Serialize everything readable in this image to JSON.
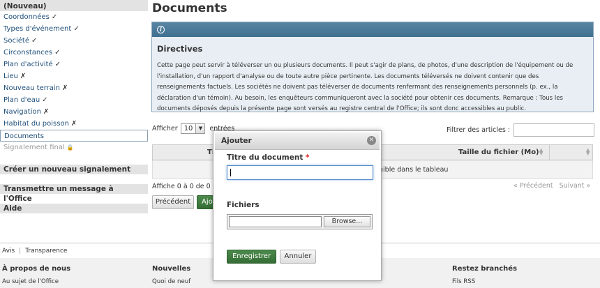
{
  "sidebar": {
    "header": "(Nouveau)",
    "items": [
      {
        "label": "Coordonnées",
        "mark": "✓"
      },
      {
        "label": "Types d'événement",
        "mark": "✓"
      },
      {
        "label": "Société",
        "mark": "✓"
      },
      {
        "label": "Circonstances",
        "mark": "✓"
      },
      {
        "label": "Plan d'activité",
        "mark": "✓"
      },
      {
        "label": "Lieu",
        "mark": "✗"
      },
      {
        "label": "Nouveau terrain",
        "mark": "✗"
      },
      {
        "label": "Plan d'eau",
        "mark": "✓"
      },
      {
        "label": "Navigation",
        "mark": "✗"
      },
      {
        "label": "Habitat du poisson",
        "mark": "✗"
      },
      {
        "label": "Documents",
        "mark": ""
      },
      {
        "label": "Signalement final",
        "mark": "🔒"
      }
    ],
    "sections": [
      "Créer un nouveau signalement",
      "Transmettre un message à l'Office",
      "Aide"
    ]
  },
  "main": {
    "title": "Documents",
    "directives": {
      "title": "Directives",
      "text": "Cette page peut servir à téléverser un ou plusieurs documents. Il peut s'agir de plans, de photos, d'une description de l'équipement ou de l'installation, d'un rapport d'analyse ou de toute autre pièce pertinente. Les documents téléversés ne doivent contenir que des renseignements factuels. Les sociétés ne doivent pas téléverser de documents renfermant des renseignements personnels (p. ex., la déclaration d'un témoin). Au besoin, les enquêteurs communiqueront avec la société pour obtenir ces documents. Remarque : Tous les documents déposés depuis la présente page sont versés au registre central de l'Office; ils sont donc accessibles au public."
    },
    "table": {
      "show_label": "Afficher",
      "show_value": "10",
      "show_after": "entrées",
      "filter_label": "Filtrer des articles :",
      "col_title_fragment": "Ti",
      "col_size": "Taille du fichier (Mo)",
      "empty_fragment": "nible dans le tableau",
      "info_fragment": "Affiche 0 à 0 de 0 e",
      "prev": "« Précédent",
      "next": "Suivant »"
    },
    "buttons": {
      "previous": "Précédent",
      "add_fragment": "Ajo"
    }
  },
  "modal": {
    "title": "Ajouter",
    "doc_title_label": "Titre du document",
    "required_mark": "*",
    "doc_title_value": "",
    "files_label": "Fichiers",
    "browse": "Browse...",
    "save": "Enregistrer",
    "cancel": "Annuler"
  },
  "footer": {
    "util": [
      "Avis",
      "Transparence"
    ],
    "sep": "|",
    "columns": [
      {
        "heading": "À propos de nous",
        "link": "Au sujet de l'Office"
      },
      {
        "heading": "Nouvelles",
        "link": "Quoi de neuf"
      },
      {
        "heading": "Restez branchés",
        "link": "Fils RSS"
      }
    ]
  }
}
